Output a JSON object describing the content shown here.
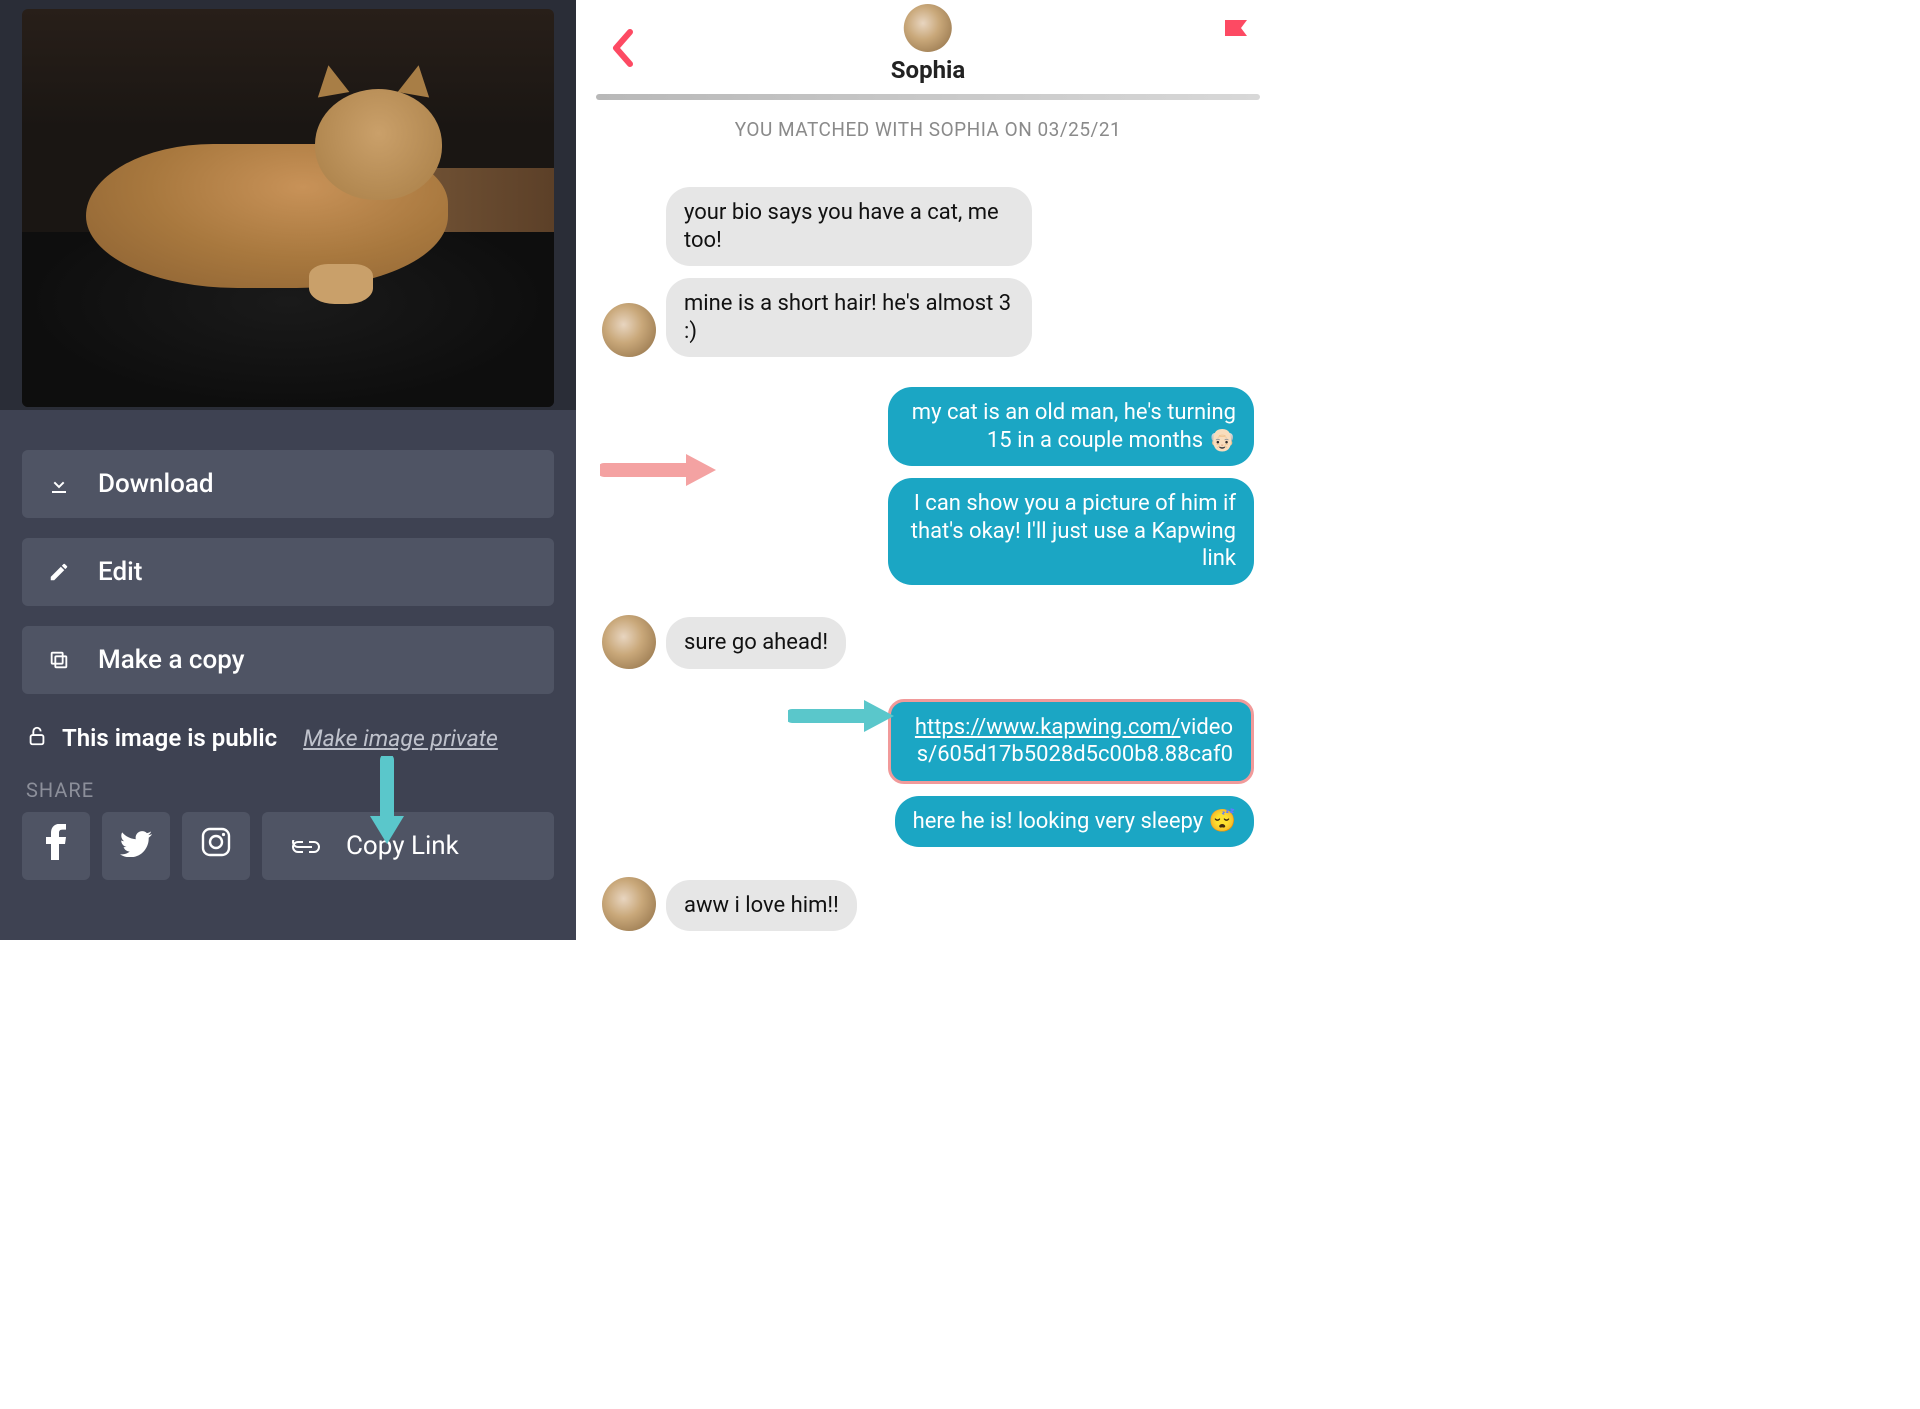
{
  "left": {
    "actions": {
      "download": "Download",
      "edit": "Edit",
      "make_copy": "Make a copy"
    },
    "privacy": {
      "label": "This image is public",
      "make_private": "Make image private"
    },
    "share_label": "SHARE",
    "copy_link": "Copy Link"
  },
  "chat": {
    "header_name": "Sophia",
    "match_text": "YOU MATCHED WITH SOPHIA ON 03/25/21",
    "messages": {
      "m1": "your bio says you have a cat, me too!",
      "m2": "mine is a short hair! he's almost 3 :)",
      "m3": "my cat is an old man, he's turning 15 in a couple months 👴🏻",
      "m4": "I can show you a picture of him if that's okay! I'll just use a Kapwing link",
      "m5": "sure go ahead!",
      "m6_link": "https://www.kapwing.com/",
      "m6_rest": "videos/605d17b5028d5c00b8.88caf0",
      "m7": "here he is! looking very sleepy 😴",
      "m8": "aww i love him!!"
    }
  }
}
